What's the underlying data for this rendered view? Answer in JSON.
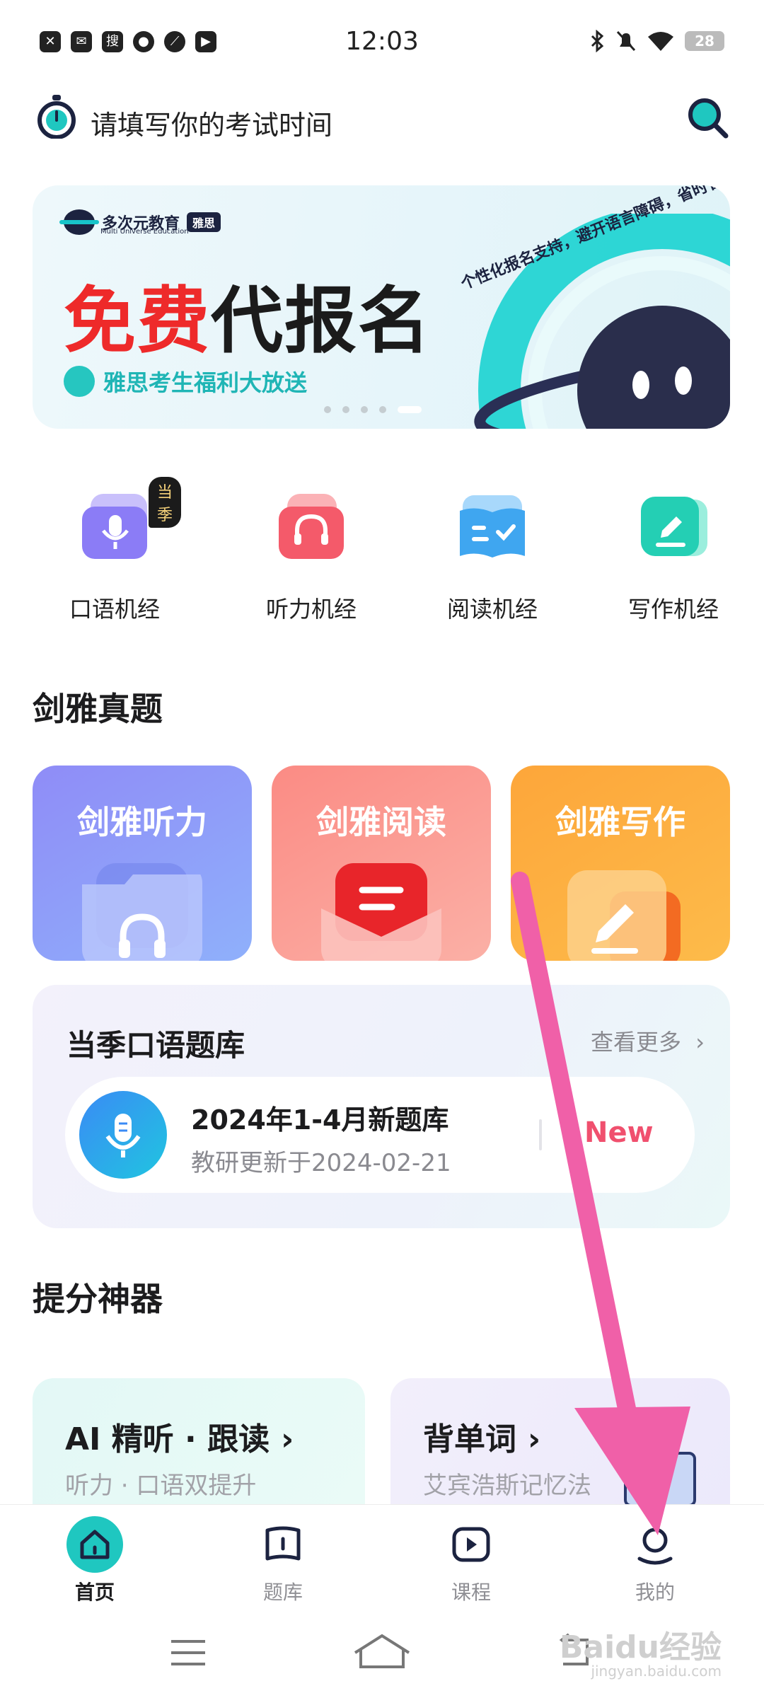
{
  "status_bar": {
    "time": "12:03",
    "left_icons": [
      "close-icon",
      "mail-icon",
      "search-app-icon",
      "chat-app-icon",
      "leaf-app-icon",
      "play-app-icon"
    ],
    "left_icon_glyph_search": "搜",
    "battery": "28"
  },
  "header": {
    "exam_time_prompt": "请填写你的考试时间"
  },
  "banner": {
    "brand_name": "多次元教育",
    "brand_tag": "雅思",
    "brand_sub": "Multi Universe Education",
    "headline_red": "免费",
    "headline_dark": "代报名",
    "slogan": "个性化报名支持，避开语言障碍，省时省力",
    "sub_text": "雅思考生福利大放送",
    "page_count": 5,
    "active_page": 5
  },
  "quick_entries": {
    "badge": "当季",
    "items": [
      {
        "label": "口语机经",
        "color": "#8b7cf6"
      },
      {
        "label": "听力机经",
        "color": "#f45a6a"
      },
      {
        "label": "阅读机经",
        "color": "#3fa6f0"
      },
      {
        "label": "写作机经",
        "color": "#24cfb4"
      }
    ]
  },
  "cambridge": {
    "title": "剑雅真题",
    "cards": [
      {
        "label": "剑雅听力"
      },
      {
        "label": "剑雅阅读"
      },
      {
        "label": "剑雅写作"
      }
    ]
  },
  "oral_bank": {
    "title": "当季口语题库",
    "more_label": "查看更多",
    "item_name": "2024年1-4月新题库",
    "item_date": "教研更新于2024-02-21",
    "new_label": "New"
  },
  "boost": {
    "title": "提分神器",
    "cards": [
      {
        "title": "AI 精听 · 跟读",
        "subtitle": "听力 · 口语双提升"
      },
      {
        "title": "背单词",
        "subtitle": "艾宾浩斯记忆法"
      }
    ]
  },
  "tabbar": {
    "tabs": [
      {
        "label": "首页",
        "icon": "home-icon",
        "active": true
      },
      {
        "label": "题库",
        "icon": "book-icon",
        "active": false
      },
      {
        "label": "课程",
        "icon": "video-icon",
        "active": false
      },
      {
        "label": "我的",
        "icon": "profile-icon",
        "active": false
      }
    ]
  },
  "watermark": {
    "text": "Baidu经验",
    "sub": "jingyan.baidu.com"
  },
  "colors": {
    "accent": "#1fc7c0",
    "headline_red": "#ee2a2a",
    "arrow_pink": "#f060a8",
    "new_label": "#f0506e"
  }
}
